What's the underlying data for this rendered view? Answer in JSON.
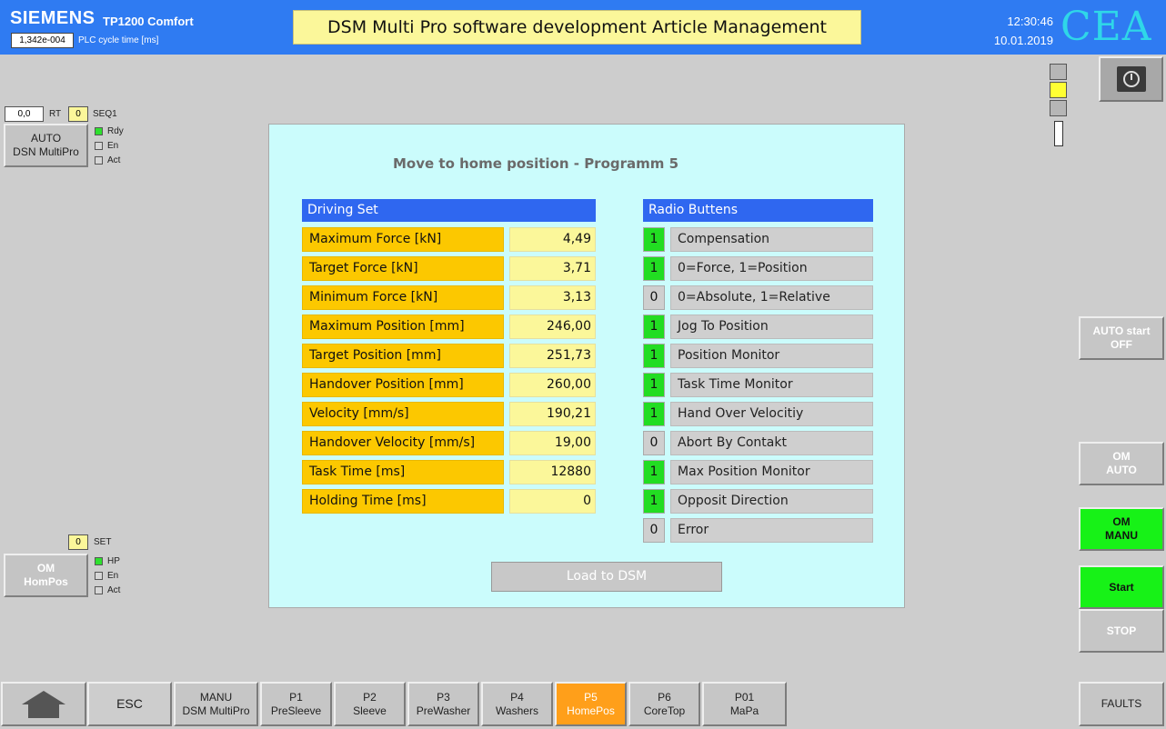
{
  "header": {
    "brand": "SIEMENS",
    "model": "TP1200 Comfort",
    "cycle_value": "1,342e-004",
    "cycle_label": "PLC cycle time [ms]",
    "title": "DSM Multi Pro software development Article Management",
    "time": "12:30:46",
    "date": "10.01.2019",
    "logo": "CEA"
  },
  "left_auto": {
    "rt_value": "0,0",
    "rt_label": "RT",
    "seq_value": "0",
    "seq_label": "SEQ1",
    "button_line1": "AUTO",
    "button_line2": "DSN MultiPro",
    "leds": [
      {
        "label": "Rdy",
        "on": true
      },
      {
        "label": "En",
        "on": false
      },
      {
        "label": "Act",
        "on": false
      }
    ]
  },
  "left_om": {
    "set_value": "0",
    "set_label": "SET",
    "button_line1": "OM",
    "button_line2": "HomPos",
    "leds": [
      {
        "label": "HP",
        "on": true
      },
      {
        "label": "En",
        "on": false
      },
      {
        "label": "Act",
        "on": false
      }
    ]
  },
  "panel": {
    "title": "Move to home position - Programm 5",
    "driving_set_header": "Driving Set",
    "radio_header": "Radio Buttens",
    "params": [
      {
        "label": "Maximum Force [kN]",
        "value": "4,49"
      },
      {
        "label": "Target Force [kN]",
        "value": "3,71"
      },
      {
        "label": "Minimum Force [kN]",
        "value": "3,13"
      },
      {
        "label": "Maximum Position [mm]",
        "value": "246,00"
      },
      {
        "label": "Target Position [mm]",
        "value": "251,73"
      },
      {
        "label": "Handover Position [mm]",
        "value": "260,00"
      },
      {
        "label": "Velocity [mm/s]",
        "value": "190,21"
      },
      {
        "label": "Handover Velocity [mm/s]",
        "value": "19,00"
      },
      {
        "label": "Task Time [ms]",
        "value": "12880"
      },
      {
        "label": "Holding Time [ms]",
        "value": "0"
      }
    ],
    "radios": [
      {
        "state": "1",
        "label": "Compensation"
      },
      {
        "state": "1",
        "label": "0=Force, 1=Position"
      },
      {
        "state": "0",
        "label": "0=Absolute, 1=Relative"
      },
      {
        "state": "1",
        "label": "Jog To Position"
      },
      {
        "state": "1",
        "label": "Position Monitor"
      },
      {
        "state": "1",
        "label": "Task Time Monitor"
      },
      {
        "state": "1",
        "label": "Hand Over Velocitiy"
      },
      {
        "state": "0",
        "label": "Abort By Contakt"
      },
      {
        "state": "1",
        "label": "Max Position Monitor"
      },
      {
        "state": "1",
        "label": "Opposit Direction"
      },
      {
        "state": "0",
        "label": "Error"
      }
    ],
    "load_button": "Load to DSM"
  },
  "right_buttons": {
    "auto_start_1": "AUTO start",
    "auto_start_2": "OFF",
    "om_auto_1": "OM",
    "om_auto_2": "AUTO",
    "om_manu_1": "OM",
    "om_manu_2": "MANU",
    "start": "Start",
    "stop": "STOP"
  },
  "nav": {
    "esc": "ESC",
    "items": [
      {
        "line1": "MANU",
        "line2": "DSM MultiPro"
      },
      {
        "line1": "P1",
        "line2": "PreSleeve"
      },
      {
        "line1": "P2",
        "line2": "Sleeve"
      },
      {
        "line1": "P3",
        "line2": "PreWasher"
      },
      {
        "line1": "P4",
        "line2": "Washers"
      },
      {
        "line1": "P5",
        "line2": "HomePos"
      },
      {
        "line1": "P6",
        "line2": "CoreTop"
      },
      {
        "line1": "P01",
        "line2": "MaPa"
      }
    ],
    "faults": "FAULTS"
  },
  "colors": {
    "header_blue": "#2f7bf2",
    "panel_bg": "#cbfcfc",
    "param_orange": "#fcc800",
    "value_yellow": "#fbf79a",
    "active_green": "#22dd22",
    "active_nav": "#ff9f1a"
  }
}
